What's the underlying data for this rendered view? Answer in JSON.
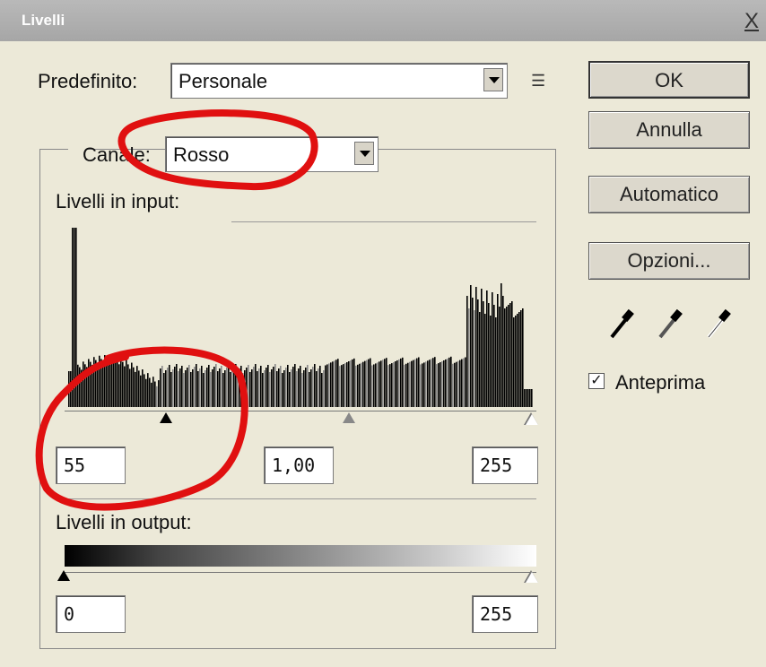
{
  "window": {
    "title": "Livelli",
    "close_label": "X"
  },
  "preset": {
    "label": "Predefinito:",
    "value": "Personale",
    "menu_icon": "list-menu-icon"
  },
  "channel": {
    "label": "Canale:",
    "value": "Rosso"
  },
  "input_levels": {
    "label": "Livelli in input:",
    "black": "55",
    "gamma": "1,00",
    "white": "255"
  },
  "output_levels": {
    "label": "Livelli in output:",
    "black": "0",
    "white": "255"
  },
  "buttons": {
    "ok": "OK",
    "cancel": "Annulla",
    "auto": "Automatico",
    "options": "Opzioni..."
  },
  "preview": {
    "label": "Anteprima",
    "checked": true
  },
  "eyedroppers": [
    "black-point-eyedropper-icon",
    "gray-point-eyedropper-icon",
    "white-point-eyedropper-icon"
  ],
  "annotation_color": "#e01010"
}
